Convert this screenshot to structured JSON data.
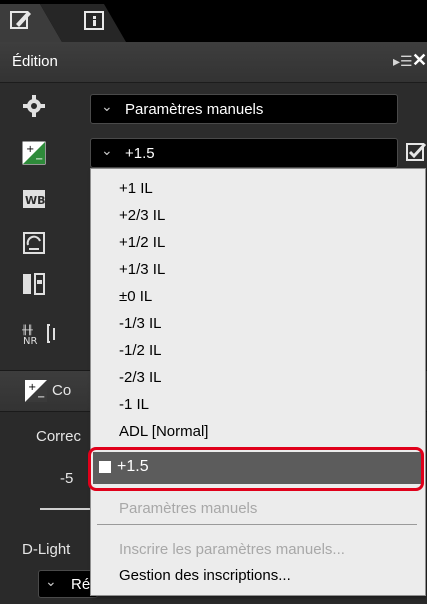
{
  "tabs": [
    {
      "name": "edit-tab",
      "icon": "pencil-square-icon",
      "active": true
    },
    {
      "name": "info-tab",
      "icon": "info-square-icon",
      "active": false
    }
  ],
  "header": {
    "title": "Édition",
    "collapse_glyph": "▸☰",
    "close_glyph": "✕"
  },
  "rows": {
    "settings_combo": {
      "icon": "gear-icon",
      "value": "Paramètres manuels"
    },
    "exposure_combo": {
      "icon": "exposure-comp-icon",
      "value": "+1.5",
      "checked": true
    },
    "wb_icon": "white-balance-icon",
    "picture_control_icon": "picture-control-icon",
    "levels_icon": "levels-curves-icon",
    "nr_icon": "noise-reduction-icon"
  },
  "lower": {
    "section_title": "Co",
    "correction_label": "Correc",
    "slider_value": "-5",
    "dlighting_label": "D-Light",
    "dlighting_value": "Ré"
  },
  "dropdown": {
    "items": [
      "+1 IL",
      "+2/3 IL",
      "+1/2 IL",
      "+1/3 IL",
      "±0 IL",
      "-1/3 IL",
      "-1/2 IL",
      "-2/3 IL",
      "-1 IL",
      "ADL [Normal]"
    ],
    "selected": "+1.5",
    "disabled_item": "Paramètres manuels",
    "disabled_register": "Inscrire les paramètres manuels...",
    "manage": "Gestion des inscriptions..."
  },
  "colors": {
    "highlight": "#e0001a",
    "panel": "#2c2c2c",
    "menu": "#ececec",
    "selected_row": "#5c5c5c"
  }
}
